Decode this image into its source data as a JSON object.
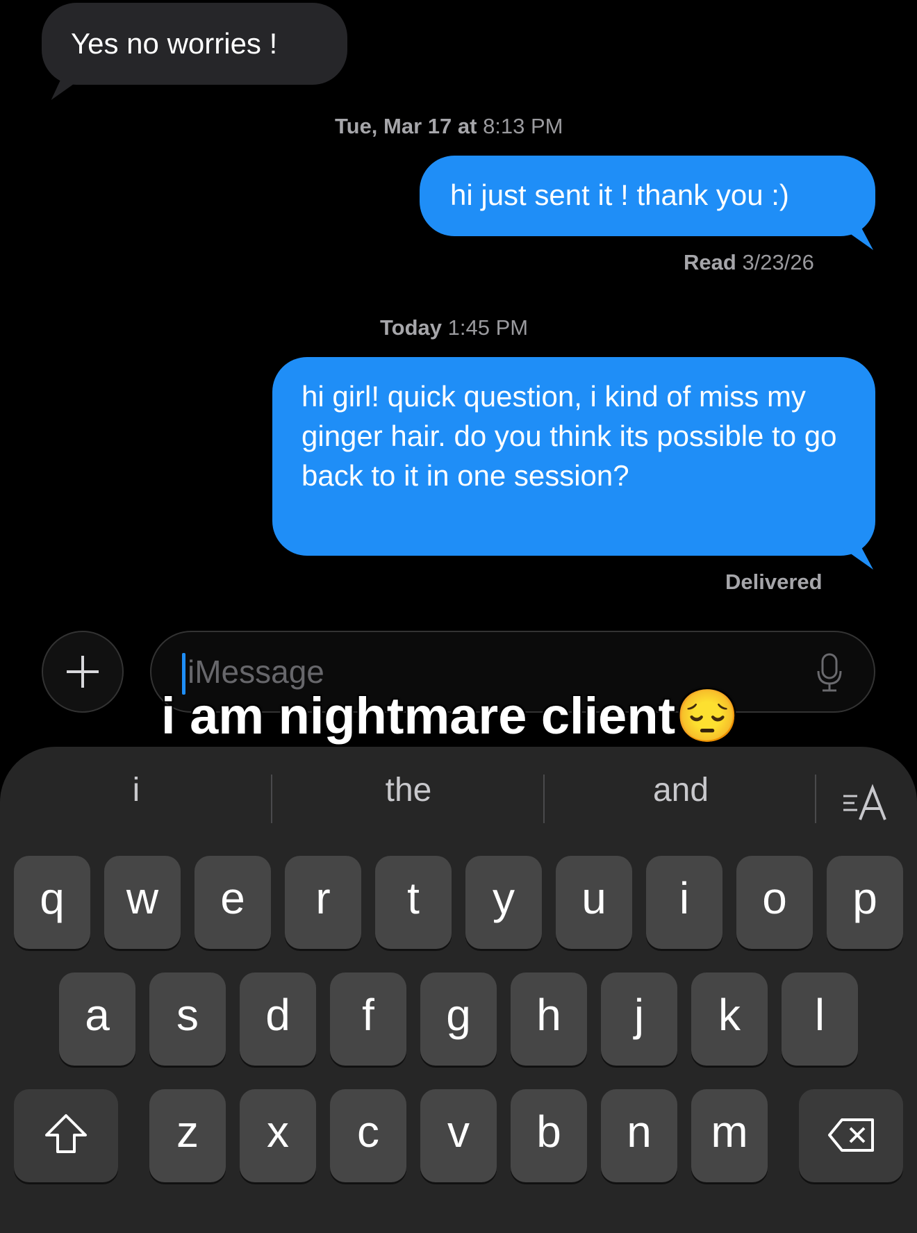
{
  "messages": {
    "m1": {
      "text": "Yes no worries !"
    },
    "ts1": {
      "day": "Tue, Mar 17 at",
      "time": "8:13 PM"
    },
    "m2": {
      "text": "hi just sent it ! thank you :)"
    },
    "read": {
      "label": "Read",
      "date": "3/23/26"
    },
    "ts2": {
      "day": "Today",
      "time": "1:45 PM"
    },
    "m3": {
      "text": "hi girl! quick question, i kind of miss my ginger hair. do you think its possible to go back to it in one session?"
    },
    "status": "Delivered"
  },
  "composer": {
    "placeholder": "iMessage"
  },
  "overlay": {
    "caption": "i am nightmare client",
    "emoji": "😔"
  },
  "keyboard": {
    "suggestions": [
      "i",
      "the",
      "and"
    ],
    "row1": [
      "q",
      "w",
      "e",
      "r",
      "t",
      "y",
      "u",
      "i",
      "o",
      "p"
    ],
    "row2": [
      "a",
      "s",
      "d",
      "f",
      "g",
      "h",
      "j",
      "k",
      "l"
    ],
    "row3": [
      "z",
      "x",
      "c",
      "v",
      "b",
      "n",
      "m"
    ]
  }
}
